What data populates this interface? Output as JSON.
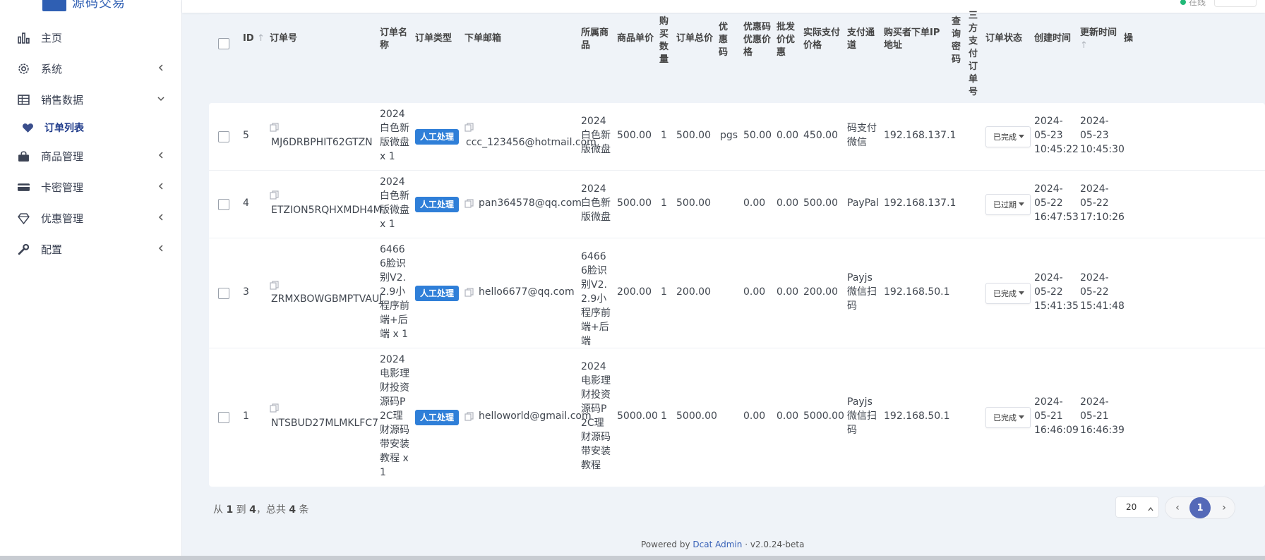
{
  "sidebar": {
    "items": [
      {
        "label": "主页",
        "icon": "bar-chart-icon"
      },
      {
        "label": "系统",
        "icon": "gear-icon"
      },
      {
        "label": "销售数据",
        "icon": "table-icon"
      },
      {
        "label": "订单列表",
        "icon": "heart-icon"
      },
      {
        "label": "商品管理",
        "icon": "shopping-bag-icon"
      },
      {
        "label": "卡密管理",
        "icon": "credit-card-icon"
      },
      {
        "label": "优惠管理",
        "icon": "diamond-icon"
      },
      {
        "label": "配置",
        "icon": "wrench-icon"
      }
    ]
  },
  "table": {
    "headers": {
      "id": "ID",
      "order_no": "订单号",
      "order_name": "订单名称",
      "order_type": "订单类型",
      "email": "下单邮箱",
      "product": "所属商品",
      "unit_price": "商品单价",
      "qty": "购买数量",
      "total": "订单总价",
      "coupon": "优惠码",
      "coupon_price": "优惠码优惠价格",
      "wholesale": "批发价优惠",
      "paid": "实际支付价格",
      "channel": "支付通道",
      "ip": "购买者下单IP地址",
      "query_pwd": "查询密码",
      "third_no": "三方支付订单号",
      "status": "订单状态",
      "created": "创建时间",
      "updated": "更新时间",
      "action": "操"
    },
    "rows": [
      {
        "id": "5",
        "order_no": "MJ6DRBPHIT62GTZN",
        "order_name": "2024白色新版微盘 x 1",
        "order_type": "人工处理",
        "email": "ccc_123456@hotmail.com",
        "product": "2024白色新版微盘",
        "unit_price": "500.00",
        "qty": "1",
        "total": "500.00",
        "coupon": "pgs",
        "coupon_price": "50.00",
        "wholesale": "0.00",
        "paid": "450.00",
        "channel": "码支付微信",
        "ip": "192.168.137.1",
        "status": "已完成",
        "created": "2024-05-23 10:45:22",
        "updated": "2024-05-23 10:45:30"
      },
      {
        "id": "4",
        "order_no": "ETZION5RQHXMDH4M",
        "order_name": "2024白色新版微盘 x 1",
        "order_type": "人工处理",
        "email": "pan364578@qq.com",
        "product": "2024白色新版微盘",
        "unit_price": "500.00",
        "qty": "1",
        "total": "500.00",
        "coupon": "",
        "coupon_price": "0.00",
        "wholesale": "0.00",
        "paid": "500.00",
        "channel": "PayPal",
        "ip": "192.168.137.1",
        "status": "已过期",
        "created": "2024-05-22 16:47:53",
        "updated": "2024-05-22 17:10:26"
      },
      {
        "id": "3",
        "order_no": "ZRMXBOWGBMPTVAUJ",
        "order_name": "64666脸识别V2.2.9小程序前端+后端 x 1",
        "order_type": "人工处理",
        "email": "hello6677@qq.com",
        "product": "64666脸识别V2.2.9小程序前端+后端",
        "unit_price": "200.00",
        "qty": "1",
        "total": "200.00",
        "coupon": "",
        "coupon_price": "0.00",
        "wholesale": "0.00",
        "paid": "200.00",
        "channel": "Payjs微信扫码",
        "ip": "192.168.50.1",
        "status": "已完成",
        "created": "2024-05-22 15:41:35",
        "updated": "2024-05-22 15:41:48"
      },
      {
        "id": "1",
        "order_no": "NTSBUD27MLMKLFC7",
        "order_name": "2024电影理财投资源码P2C理财源码带安装教程 x 1",
        "order_type": "人工处理",
        "email": "helloworld@gmail.com",
        "product": "2024电影理财投资源码P2C理财源码带安装教程",
        "unit_price": "5000.00",
        "qty": "1",
        "total": "5000.00",
        "coupon": "",
        "coupon_price": "0.00",
        "wholesale": "0.00",
        "paid": "5000.00",
        "channel": "Payjs微信扫码",
        "ip": "192.168.50.1",
        "status": "已完成",
        "created": "2024-05-21 16:46:09",
        "updated": "2024-05-21 16:46:39"
      }
    ]
  },
  "footer": {
    "range_prefix": "从",
    "from": "1",
    "to_word": "到",
    "to": "4",
    "total_word": "，总共",
    "total": "4",
    "unit": "条",
    "per_page": "20",
    "current_page": "1",
    "powered_by": "Powered by",
    "brand": "Dcat Admin",
    "version": "· v2.0.24-beta"
  },
  "topbar": {
    "online": "在线"
  },
  "colors": {
    "accent": "#5469b8",
    "badge": "#2f7fd8",
    "online": "#21b978"
  }
}
